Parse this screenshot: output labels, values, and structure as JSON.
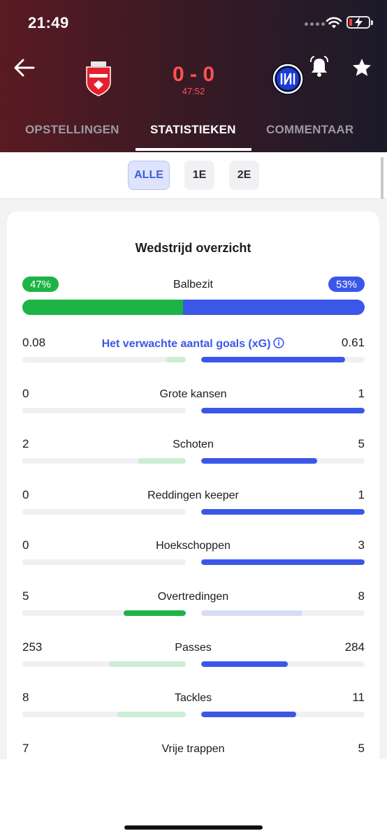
{
  "status_bar": {
    "time": "21:49"
  },
  "match": {
    "home_team_crest": "monza-crest-icon",
    "away_team_crest": "inter-crest-icon",
    "score": "0 - 0",
    "clock": "47:52"
  },
  "tabs": [
    {
      "label": "OPSTELLINGEN"
    },
    {
      "label": "STATISTIEKEN",
      "active": true
    },
    {
      "label": "COMMENTAAR"
    }
  ],
  "periods": [
    {
      "label": "ALLE",
      "active": true
    },
    {
      "label": "1E"
    },
    {
      "label": "2E"
    }
  ],
  "stats": {
    "title": "Wedstrijd overzicht",
    "possession": {
      "label": "Balbezit",
      "home": "47%",
      "away": "53%",
      "home_fraction": 0.47
    },
    "rows": [
      {
        "label": "Het verwachte aantal goals (xG)",
        "home": "0.08",
        "away": "0.61",
        "home_fill": 0.12,
        "away_fill": 0.88,
        "home_leads": false,
        "info": true
      },
      {
        "label": "Grote kansen",
        "home": "0",
        "away": "1",
        "home_fill": 0,
        "away_fill": 1.0,
        "home_leads": false
      },
      {
        "label": "Schoten",
        "home": "2",
        "away": "5",
        "home_fill": 0.29,
        "away_fill": 0.71,
        "home_leads": false
      },
      {
        "label": "Reddingen keeper",
        "home": "0",
        "away": "1",
        "home_fill": 0,
        "away_fill": 1.0,
        "home_leads": false
      },
      {
        "label": "Hoekschoppen",
        "home": "0",
        "away": "3",
        "home_fill": 0,
        "away_fill": 1.0,
        "home_leads": false
      },
      {
        "label": "Overtredingen",
        "home": "5",
        "away": "8",
        "home_fill": 0.38,
        "away_fill": 0.62,
        "home_leads": true
      },
      {
        "label": "Passes",
        "home": "253",
        "away": "284",
        "home_fill": 0.47,
        "away_fill": 0.53,
        "home_leads": false
      },
      {
        "label": "Tackles",
        "home": "8",
        "away": "11",
        "home_fill": 0.42,
        "away_fill": 0.58,
        "home_leads": false
      },
      {
        "label": "Vrije trappen",
        "home": "7",
        "away": "5",
        "home_fill": 0.58,
        "away_fill": 0.42,
        "home_leads": true
      }
    ]
  },
  "colors": {
    "home": "#1db446",
    "away": "#3b57e8",
    "score": "#ff5252"
  }
}
